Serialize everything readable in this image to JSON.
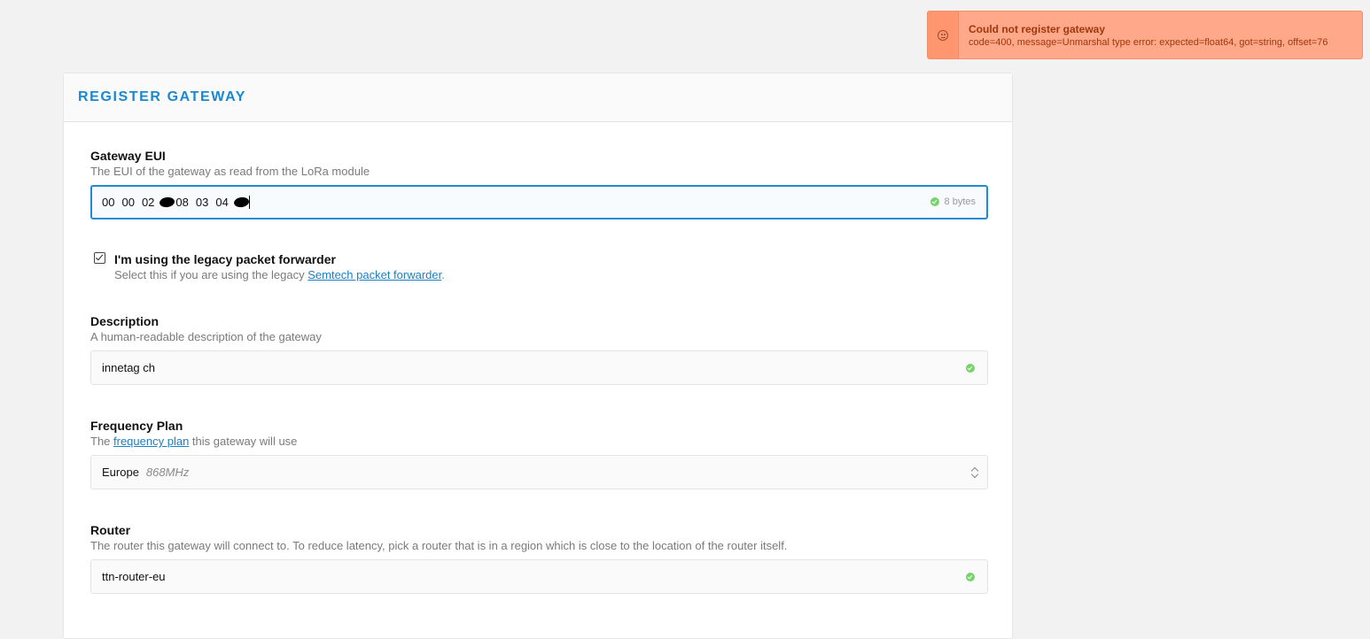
{
  "toast": {
    "icon": "sad-face-icon",
    "title": "Could not register gateway",
    "message": "code=400, message=Unmarshal type error: expected=float64, got=string, offset=76",
    "color": "#ffa88a"
  },
  "page": {
    "title": "REGISTER GATEWAY",
    "accent_color": "#1a88d0"
  },
  "gateway_eui": {
    "label": "Gateway EUI",
    "description": "The EUI of the gateway as read from the LoRa module",
    "bytes": [
      "00",
      "00",
      "02",
      "",
      "08",
      "03",
      "04",
      ""
    ],
    "hint": "8 bytes"
  },
  "legacy": {
    "label": "I'm using the legacy packet forwarder",
    "description_prefix": "Select this if you are using the legacy ",
    "link_text": "Semtech packet forwarder",
    "description_suffix": ".",
    "checked": true
  },
  "description_field": {
    "label": "Description",
    "description": "A human-readable description of the gateway",
    "value": "innetag ch"
  },
  "frequency_plan": {
    "label": "Frequency Plan",
    "description_prefix": "The ",
    "link_text": "frequency plan",
    "description_suffix": " this gateway will use",
    "selected": "Europe",
    "selected_unit": "868MHz"
  },
  "router": {
    "label": "Router",
    "description": "The router this gateway will connect to. To reduce latency, pick a router that is in a region which is close to the location of the router itself.",
    "value": "ttn-router-eu"
  }
}
